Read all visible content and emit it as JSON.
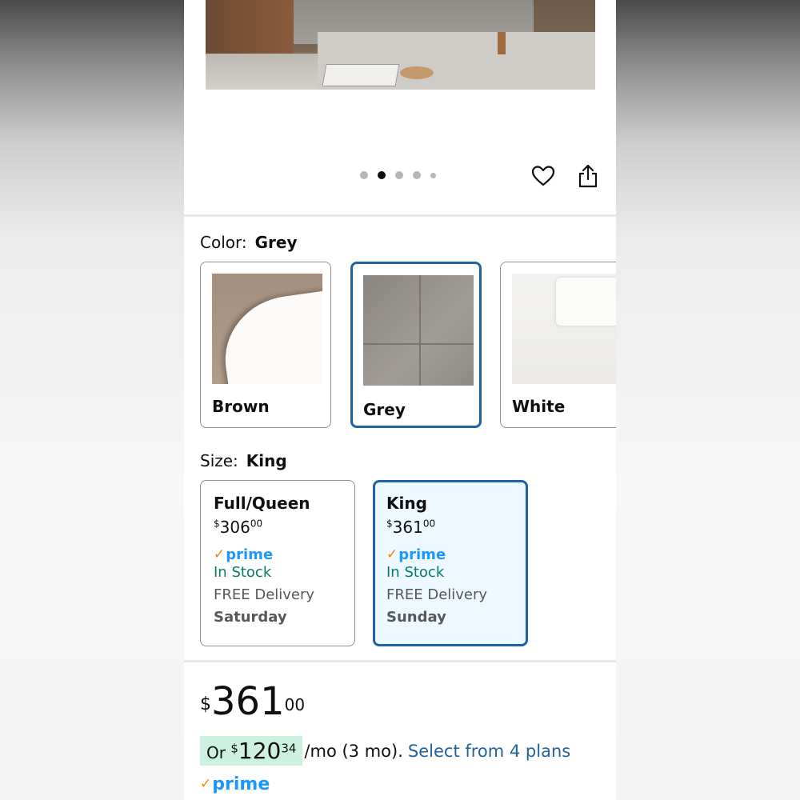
{
  "colors": {
    "accent": "#2162a1",
    "selected_bg": "#edf8ff",
    "in_stock": "#067d62",
    "prime_blue": "#1a98ff",
    "prime_check": "#f08804",
    "highlight": "#cdf1e0"
  },
  "carousel": {
    "total_dots": 5,
    "active_index": 1
  },
  "icons": {
    "favorite": "heart-icon",
    "share": "share-icon"
  },
  "color_selector": {
    "label": "Color:",
    "selected": "Grey",
    "options": [
      {
        "name": "Brown"
      },
      {
        "name": "Grey"
      },
      {
        "name": "White"
      }
    ]
  },
  "size_selector": {
    "label": "Size:",
    "selected": "King",
    "options": [
      {
        "name": "Full/Queen",
        "price_symbol": "$",
        "price_whole": "306",
        "price_fraction": "00",
        "prime": "prime",
        "stock": "In Stock",
        "delivery": "FREE Delivery",
        "day": "Saturday"
      },
      {
        "name": "King",
        "price_symbol": "$",
        "price_whole": "361",
        "price_fraction": "00",
        "prime": "prime",
        "stock": "In Stock",
        "delivery": "FREE Delivery",
        "day": "Sunday"
      }
    ]
  },
  "price": {
    "symbol": "$",
    "whole": "361",
    "fraction": "00",
    "installment_prefix": "Or",
    "installment_symbol": "$",
    "installment_whole": "120",
    "installment_fraction": "34",
    "installment_suffix": "/mo (3 mo).",
    "plans_link": "Select from 4 plans",
    "prime": "prime"
  }
}
